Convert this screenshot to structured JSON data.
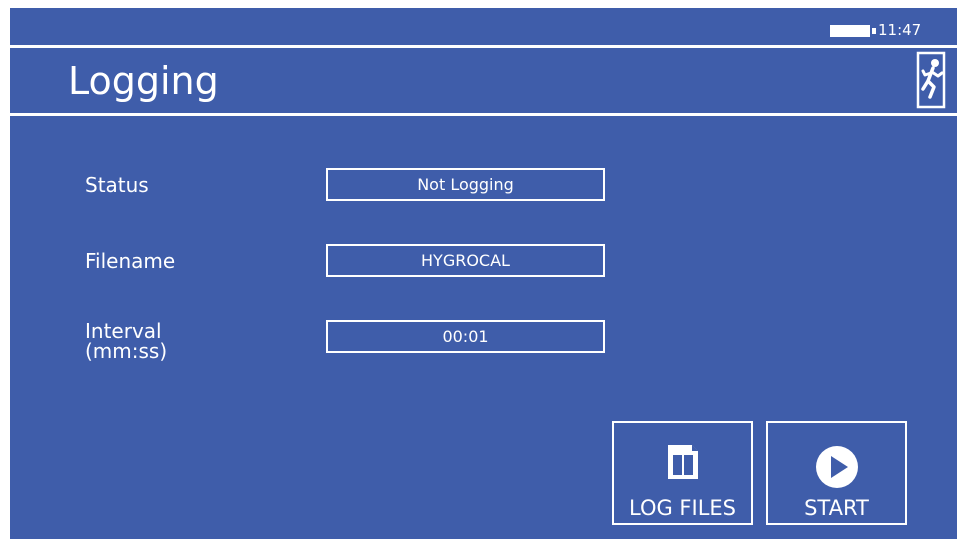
{
  "status_bar": {
    "time": "11:47",
    "battery_icon": "battery-full-icon"
  },
  "header": {
    "title": "Logging",
    "exit_icon": "exit-running-man-icon"
  },
  "fields": {
    "status": {
      "label": "Status",
      "value": "Not Logging"
    },
    "filename": {
      "label": "Filename",
      "value": "HYGROCAL"
    },
    "interval": {
      "label_line1": "Interval",
      "label_line2": "(mm:ss)",
      "value": "00:01"
    }
  },
  "buttons": {
    "log_files": {
      "label": "LOG FILES",
      "icon": "file-icon"
    },
    "start": {
      "label": "START",
      "icon": "play-icon"
    }
  },
  "colors": {
    "background": "#3f5daa",
    "foreground": "#ffffff"
  }
}
